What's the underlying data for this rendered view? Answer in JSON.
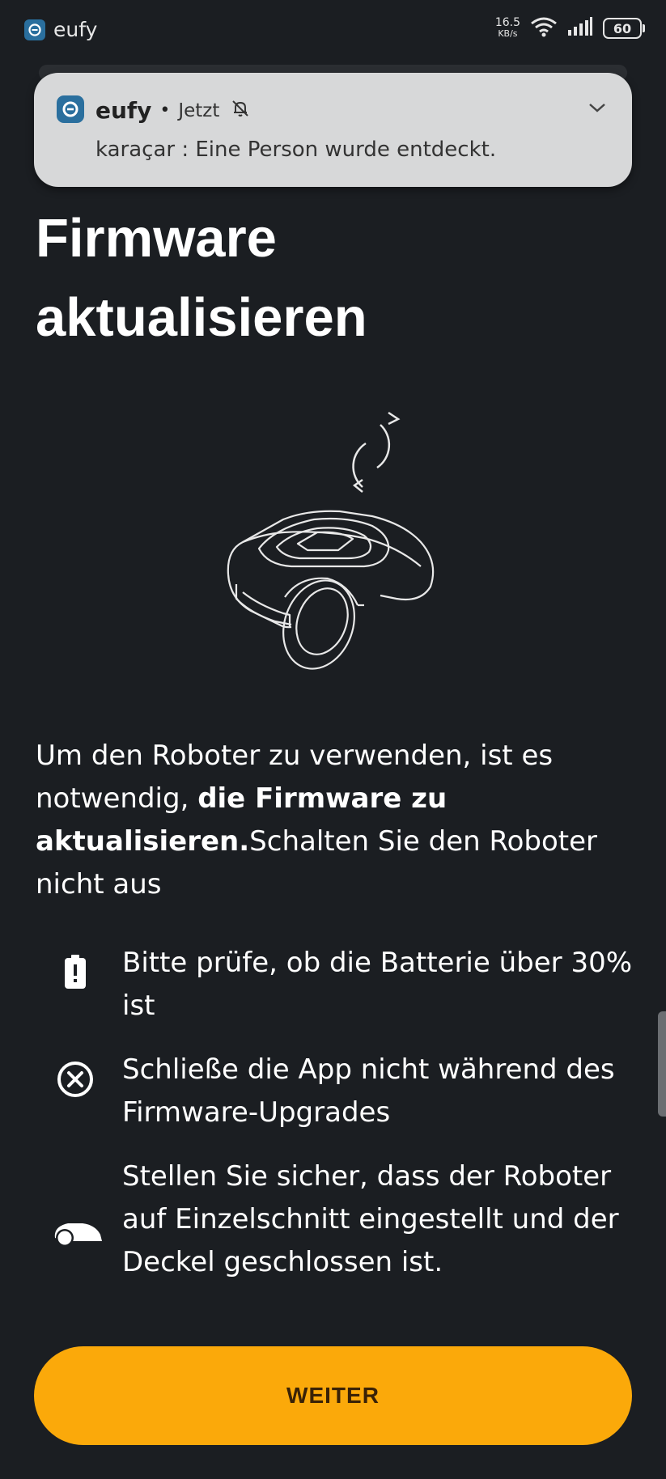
{
  "status_bar": {
    "app_name": "eufy",
    "net_speed": "16.5",
    "net_speed_unit": "KB/s",
    "battery_level": "60"
  },
  "notification": {
    "app_name": "eufy",
    "separator": "•",
    "time": "Jetzt",
    "message": "karaçar : Eine Person wurde entdeckt."
  },
  "page": {
    "title_line1": "Firmware",
    "title_line2": "aktualisieren",
    "desc_part1": "Um den Roboter zu verwenden, ist es notwendig, ",
    "desc_bold": "die Firmware zu aktualisieren.",
    "desc_part2": "Schalten Sie den Roboter nicht aus"
  },
  "requirements": [
    {
      "icon": "battery-alert-icon",
      "text": "Bitte prüfe, ob die Batterie über 30% ist"
    },
    {
      "icon": "close-circle-icon",
      "text": "Schließe die App nicht während des Firmware-Upgrades"
    },
    {
      "icon": "mower-icon",
      "text": "Stellen Sie sicher, dass der Roboter auf Einzelschnitt eingestellt und der Deckel geschlossen ist."
    }
  ],
  "cta": {
    "label": "WEITER"
  },
  "colors": {
    "background": "#1b1e22",
    "accent": "#fba90a",
    "notification_bg": "#d7d8d9"
  }
}
